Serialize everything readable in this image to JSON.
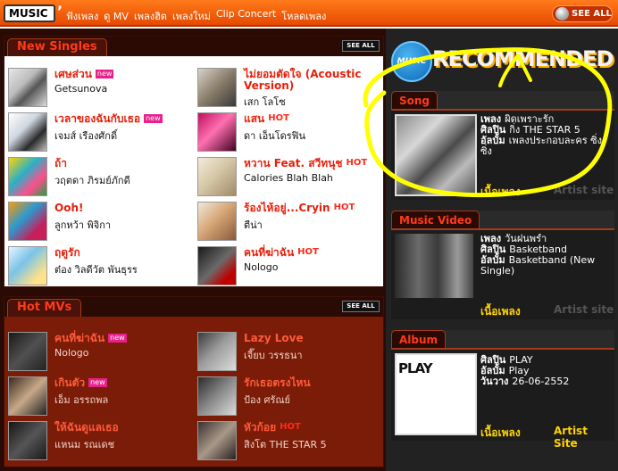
{
  "topbar": {
    "logo": "MUSIC",
    "nav": [
      "ฟังเพลง",
      "ดู MV",
      "เพลงฮิต",
      "เพลงใหม่",
      "Clip Concert",
      "โหลดเพลง"
    ],
    "see_all": "SEE ALL"
  },
  "new_singles": {
    "title": "New Singles",
    "see_all": "SEE ALL",
    "items": [
      {
        "title": "เศษส่วน",
        "artist": "Getsunova",
        "badge": "new"
      },
      {
        "title": "ไม่ยอมตัดใจ (Acoustic Version)",
        "artist": "เสก โลโซ",
        "badge": ""
      },
      {
        "title": "เวลาของฉันกับเธอ",
        "artist": "เจมส์ เรืองศักดิ์",
        "badge": "new"
      },
      {
        "title": "แสน",
        "artist": "ดา เอ็นโดรฟิน",
        "badge": "HOT"
      },
      {
        "title": "ถ้า",
        "artist": "วฤตดา ภิรมย์ภักดี",
        "badge": ""
      },
      {
        "title": "หวาน Feat. สวีทนุช",
        "artist": "Calories Blah Blah",
        "badge": "HOT"
      },
      {
        "title": "Ooh!",
        "artist": "ลูกหว้า พิจิกา",
        "badge": ""
      },
      {
        "title": "ร้องไห้อยู่...Cryin",
        "artist": "ตีน่า",
        "badge": "HOT"
      },
      {
        "title": "ฤดูรัก",
        "artist": "ต๋อง วิลดีวัต พันธุรร",
        "badge": ""
      },
      {
        "title": "คนที่ฆ่าฉัน",
        "artist": "Nologo",
        "badge": "HOT"
      }
    ]
  },
  "hot_mvs": {
    "title": "Hot MVs",
    "see_all": "SEE ALL",
    "items": [
      {
        "title": "คนที่ฆ่าฉัน",
        "artist": "Nologo",
        "badge": "new"
      },
      {
        "title": "Lazy Love",
        "artist": "เจี๊ยบ วรรธนา",
        "badge": ""
      },
      {
        "title": "เกินตัว",
        "artist": "เอ็ม อรรถพล",
        "badge": "new"
      },
      {
        "title": "รักเธอตรงไหน",
        "artist": "ป้อง ศรัณย์",
        "badge": ""
      },
      {
        "title": "ให้ฉันดูแลเธอ",
        "artist": "แหนม รณเดช",
        "badge": ""
      },
      {
        "title": "หัวก้อย",
        "artist": "สิงโต THE STAR 5",
        "badge": "HOT"
      }
    ]
  },
  "recommended": {
    "badge": "MUSIC",
    "title": "RECOMMENDED",
    "song": {
      "tab": "Song",
      "song_label": "เพลง",
      "song_value": "ผิดเพราะรัก",
      "artist_label": "ศิลปิน",
      "artist_value": "กิ่ง THE STAR 5",
      "album_label": "อัลบั้ม",
      "album_value": "เพลงประกอบละคร ซิ่งซิ่ง",
      "lyrics": "เนื้อเพลง",
      "artist_site": "Artist site"
    },
    "music_video": {
      "tab": "Music Video",
      "song_label": "เพลง",
      "song_value": "วันฝนพรำ",
      "artist_label": "ศิลปิน",
      "artist_value": "Basketband",
      "album_label": "อัลบั้ม",
      "album_value": "Basketband (New Single)",
      "lyrics": "เนื้อเพลง",
      "artist_site": "Artist site"
    },
    "album": {
      "tab": "Album",
      "cover_text": "PLAY",
      "artist_label": "ศิลปิน",
      "artist_value": "PLAY",
      "album_label": "อัลบั้ม",
      "album_value": "Play",
      "date_label": "วันวาง",
      "date_value": "26-06-2552",
      "lyrics": "เนื้อเพลง",
      "artist_site": "Artist Site"
    }
  },
  "colors": {
    "accent": "#ff3a1a",
    "topbar": "#f0560a",
    "highlight": "#ffff00",
    "link": "#ffd200"
  }
}
